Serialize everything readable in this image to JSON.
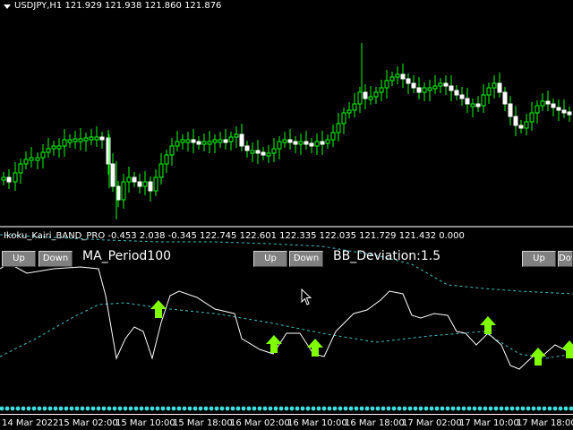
{
  "chart_header": {
    "symbol_info": "USDJPY,H1  121.929 121.938 121.860 121.876"
  },
  "indicator_header": {
    "text": "Ikoku_Kairi_BAND_PRO -0.453 2.038 -0.345 122.745 122.601 122.335 122.035 121.729 121.432 0.000"
  },
  "controls": {
    "group1": {
      "up": "Up",
      "down": "Down",
      "param": "MA_Period100"
    },
    "group2": {
      "up": "Up",
      "down": "Down",
      "param": "BB_Deviation:1.5"
    },
    "group3": {
      "up": "Up",
      "down": "Down"
    }
  },
  "time_axis": [
    "14 Mar 2022",
    "15 Mar 02:00",
    "15 Mar 10:00",
    "15 Mar 18:00",
    "16 Mar 02:00",
    "16 Mar 10:00",
    "16 Mar 18:00",
    "17 Mar 02:00",
    "17 Mar 10:00",
    "17 Mar 18:00"
  ],
  "colors": {
    "bull": "#00ff00",
    "bear": "#ffffff",
    "band": "#3fbfbf",
    "arrow": "#7fff00",
    "dots": "#40e0e0"
  },
  "icons": [
    "dropdown-triangle-icon",
    "mouse-cursor-icon",
    "up-arrow-icon"
  ]
}
